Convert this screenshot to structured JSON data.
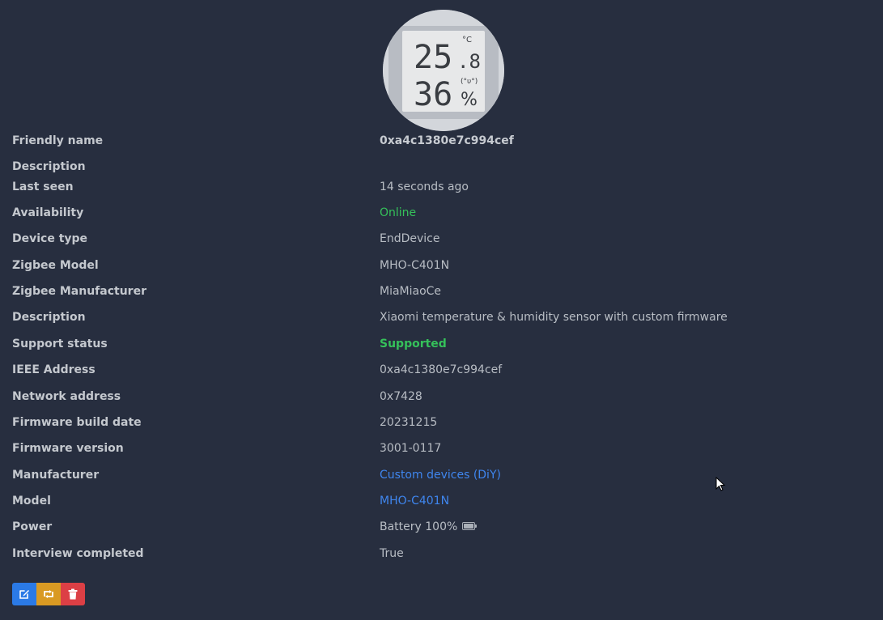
{
  "device_image": {
    "icon": "e-ink-thermometer-display",
    "temperature": "25",
    "temperature_decimal": ".8",
    "temperature_unit": "°C",
    "humidity": "36",
    "humidity_unit": "%"
  },
  "rows": [
    {
      "label": "Friendly name",
      "value": "0xa4c1380e7c994cef"
    },
    {
      "label": "Description",
      "value": ""
    },
    {
      "label": "Last seen",
      "value": "14 seconds ago"
    },
    {
      "label": "Availability",
      "value": "Online"
    },
    {
      "label": "Device type",
      "value": "EndDevice"
    },
    {
      "label": "Zigbee Model",
      "value": "MHO-C401N"
    },
    {
      "label": "Zigbee Manufacturer",
      "value": "MiaMiaoCe"
    },
    {
      "label": "Description",
      "value": "Xiaomi temperature & humidity sensor with custom firmware"
    },
    {
      "label": "Support status",
      "value": "Supported"
    },
    {
      "label": "IEEE Address",
      "value": "0xa4c1380e7c994cef"
    },
    {
      "label": "Network address",
      "value": "0x7428"
    },
    {
      "label": "Firmware build date",
      "value": "20231215"
    },
    {
      "label": "Firmware version",
      "value": "3001-0117"
    },
    {
      "label": "Manufacturer",
      "value": "Custom devices (DiY)"
    },
    {
      "label": "Model",
      "value": "MHO-C401N"
    },
    {
      "label": "Power",
      "value": "Battery 100%",
      "icon": "battery-icon"
    },
    {
      "label": "Interview completed",
      "value": "True"
    }
  ],
  "actions": {
    "edit_icon": "edit-icon",
    "interview_icon": "interview-icon",
    "remove_icon": "trash-icon"
  },
  "colors": {
    "background": "#272e3f",
    "online": "#35c15a",
    "link": "#3f86ef",
    "edit_button": "#2b7ae6",
    "interview_button": "#d99a23",
    "remove_button": "#dc3f45"
  }
}
